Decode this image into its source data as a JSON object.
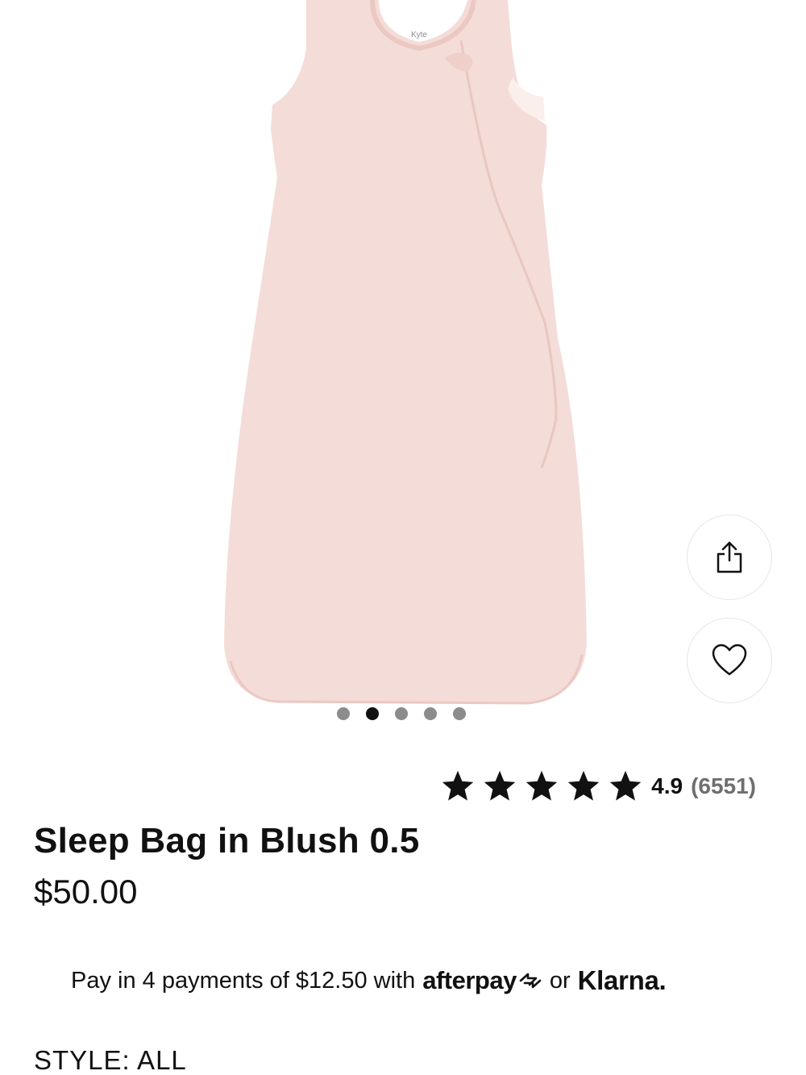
{
  "gallery": {
    "image_label": "Kyte",
    "slide_count": 5,
    "active_slide": 2
  },
  "actions": {
    "share_icon": "share-icon",
    "favorite_icon": "heart-icon"
  },
  "rating": {
    "stars": 5,
    "value": "4.9",
    "count": "(6551)"
  },
  "product": {
    "title": "Sleep Bag in Blush 0.5",
    "price": "$50.00"
  },
  "payments": {
    "text": "Pay in 4 payments of $12.50 with",
    "afterpay": "afterpay",
    "or": "or",
    "klarna": "Klarna."
  },
  "style": {
    "label": "STYLE: ALL"
  },
  "colors": {
    "product": "#f4dcd8",
    "active_dot": "#111111",
    "inactive_dot": "#8c8c8c",
    "muted_text": "#6f6f6f"
  }
}
